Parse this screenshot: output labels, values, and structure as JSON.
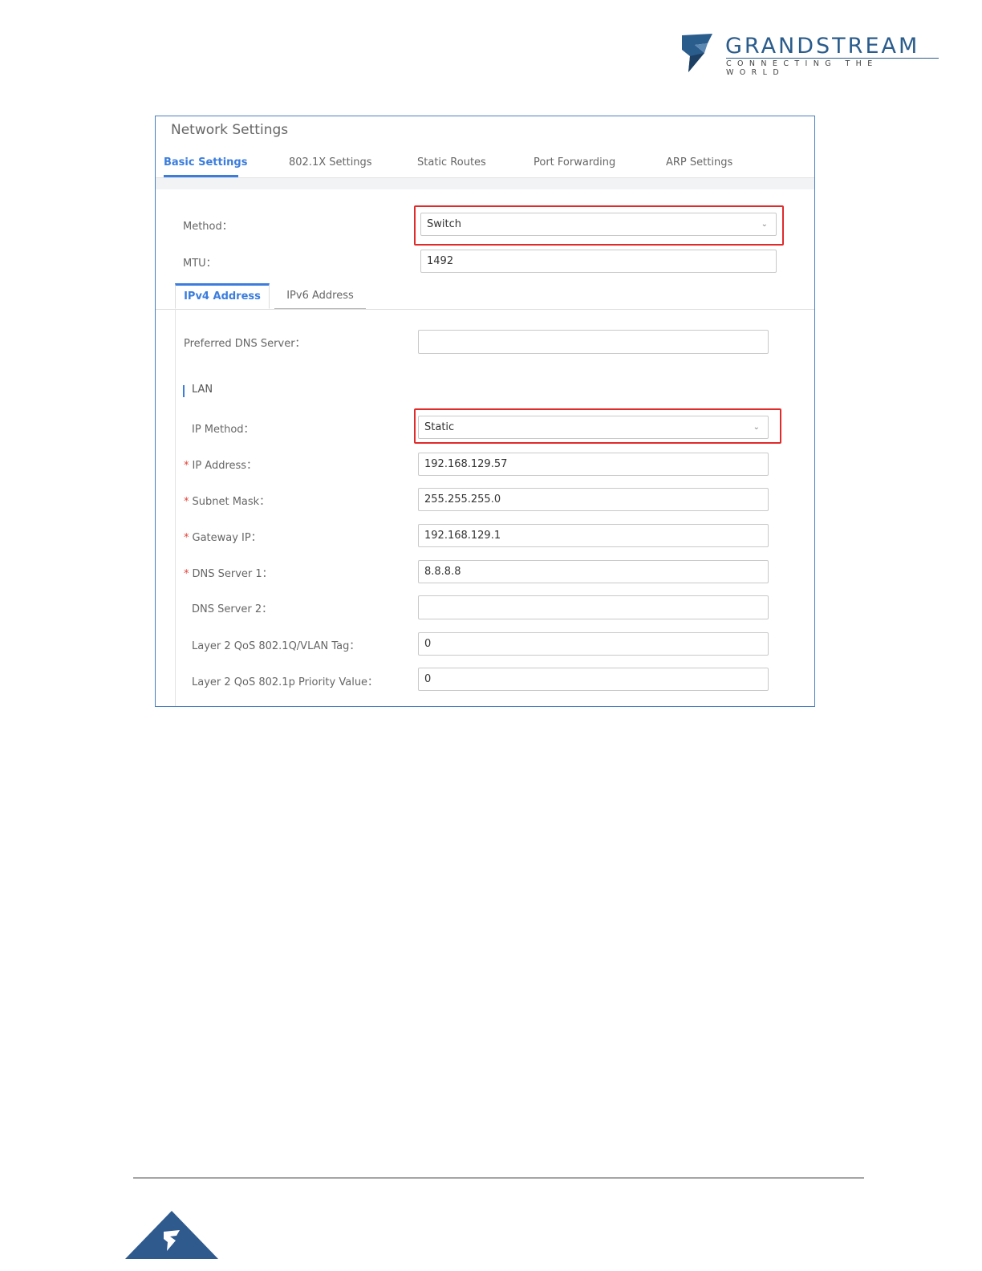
{
  "brand": {
    "name": "GRANDSTREAM",
    "tagline": "CONNECTING THE WORLD",
    "color": "#2a5c8c"
  },
  "page": {
    "title": "Network Settings",
    "tabs": [
      "Basic Settings",
      "802.1X Settings",
      "Static Routes",
      "Port Forwarding",
      "ARP Settings"
    ],
    "active_tab": "Basic Settings"
  },
  "basic": {
    "method_label": "Method：",
    "method_value": "Switch",
    "mtu_label": "MTU：",
    "mtu_value": "1492"
  },
  "address_tabs": {
    "ipv4": "IPv4 Address",
    "ipv6": "IPv6 Address",
    "active": "IPv4 Address"
  },
  "ipv4": {
    "preferred_dns_label": "Preferred DNS Server：",
    "preferred_dns_value": "",
    "lan_heading": "LAN",
    "ip_method_label": "IP Method：",
    "ip_method_value": "Static",
    "ip_address_label": "IP Address：",
    "ip_address_value": "192.168.129.57",
    "subnet_mask_label": "Subnet Mask：",
    "subnet_mask_value": "255.255.255.0",
    "gateway_label": "Gateway IP：",
    "gateway_value": "192.168.129.1",
    "dns1_label": "DNS Server 1：",
    "dns1_value": "8.8.8.8",
    "dns2_label": "DNS Server 2：",
    "dns2_value": "",
    "vlan_label": "Layer 2 QoS 802.1Q/VLAN Tag：",
    "vlan_value": "0",
    "priority_label": "Layer 2 QoS 802.1p Priority Value：",
    "priority_value": "0",
    "required_mark": "*"
  },
  "colors": {
    "accent": "#3b7ddd",
    "highlight": "#e02b2b",
    "required": "#e0453a"
  },
  "icons": {
    "dropdown": "chevron-down-icon"
  }
}
